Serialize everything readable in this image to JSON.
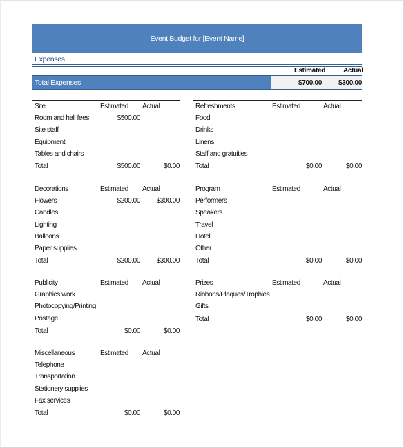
{
  "title": "Event Budget for [Event Name]",
  "expenses_label": "Expenses",
  "summary": {
    "estimated_header": "Estimated",
    "actual_header": "Actual",
    "total_label": "Total Expenses",
    "total_estimated": "$700.00",
    "total_actual": "$300.00"
  },
  "colors": {
    "accent": "#4f81bd",
    "rule": "#365f91",
    "total_fill": "#f2f2f2"
  },
  "sections": {
    "site": {
      "name": "Site",
      "estimated": "Estimated",
      "actual": "Actual",
      "items": [
        {
          "label": "Room and hall fees",
          "estimated": "$500.00",
          "actual": ""
        },
        {
          "label": "Site staff",
          "estimated": "",
          "actual": ""
        },
        {
          "label": "Equipment",
          "estimated": "",
          "actual": ""
        },
        {
          "label": "Tables and chairs",
          "estimated": "",
          "actual": ""
        }
      ],
      "total_label": "Total",
      "total_estimated": "$500.00",
      "total_actual": "$0.00"
    },
    "refreshments": {
      "name": "Refreshments",
      "estimated": "Estimated",
      "actual": "Actual",
      "items": [
        {
          "label": "Food",
          "estimated": "",
          "actual": ""
        },
        {
          "label": "Drinks",
          "estimated": "",
          "actual": ""
        },
        {
          "label": "Linens",
          "estimated": "",
          "actual": ""
        },
        {
          "label": "Staff and gratuities",
          "estimated": "",
          "actual": ""
        }
      ],
      "total_label": "Total",
      "total_estimated": "$0.00",
      "total_actual": "$0.00"
    },
    "decorations": {
      "name": "Decorations",
      "estimated": "Estimated",
      "actual": "Actual",
      "items": [
        {
          "label": "Flowers",
          "estimated": "$200.00",
          "actual": "$300.00"
        },
        {
          "label": "Candles",
          "estimated": "",
          "actual": ""
        },
        {
          "label": "Lighting",
          "estimated": "",
          "actual": ""
        },
        {
          "label": "Balloons",
          "estimated": "",
          "actual": ""
        },
        {
          "label": "Paper supplies",
          "estimated": "",
          "actual": ""
        }
      ],
      "total_label": "Total",
      "total_estimated": "$200.00",
      "total_actual": "$300.00"
    },
    "program": {
      "name": "Program",
      "estimated": "Estimated",
      "actual": "Actual",
      "items": [
        {
          "label": "Performers",
          "estimated": "",
          "actual": ""
        },
        {
          "label": "Speakers",
          "estimated": "",
          "actual": ""
        },
        {
          "label": "Travel",
          "estimated": "",
          "actual": ""
        },
        {
          "label": "Hotel",
          "estimated": "",
          "actual": ""
        },
        {
          "label": "Other",
          "estimated": "",
          "actual": ""
        }
      ],
      "total_label": "Total",
      "total_estimated": "$0.00",
      "total_actual": "$0.00"
    },
    "publicity": {
      "name": "Publicity",
      "estimated": "Estimated",
      "actual": "Actual",
      "items": [
        {
          "label": "Graphics work",
          "estimated": "",
          "actual": ""
        },
        {
          "label": "Photocopying/Printing",
          "estimated": "",
          "actual": ""
        },
        {
          "label": "Postage",
          "estimated": "",
          "actual": ""
        }
      ],
      "total_label": "Total",
      "total_estimated": "$0.00",
      "total_actual": "$0.00"
    },
    "prizes": {
      "name": "Prizes",
      "estimated": "Estimated",
      "actual": "Actual",
      "items": [
        {
          "label": "Ribbons/Plaques/Trophies",
          "estimated": "",
          "actual": ""
        },
        {
          "label": "Gifts",
          "estimated": "",
          "actual": ""
        }
      ],
      "total_label": "Total",
      "total_estimated": "$0.00",
      "total_actual": "$0.00"
    },
    "miscellaneous": {
      "name": "Miscellaneous",
      "estimated": "Estimated",
      "actual": "Actual",
      "items": [
        {
          "label": "Telephone",
          "estimated": "",
          "actual": ""
        },
        {
          "label": "Transportation",
          "estimated": "",
          "actual": ""
        },
        {
          "label": "Stationery supplies",
          "estimated": "",
          "actual": ""
        },
        {
          "label": "Fax services",
          "estimated": "",
          "actual": ""
        }
      ],
      "total_label": "Total",
      "total_estimated": "$0.00",
      "total_actual": "$0.00"
    }
  }
}
